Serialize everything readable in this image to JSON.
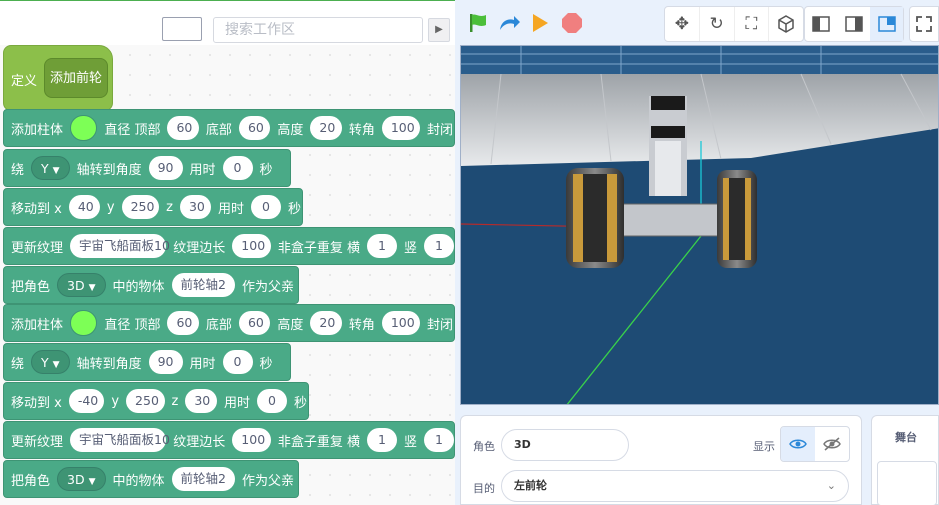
{
  "toolbar": {
    "search_placeholder": "搜索工作区"
  },
  "code": {
    "hat": {
      "label": "定义",
      "name": "添加前轮"
    },
    "blocks": [
      {
        "add_cyl": "添加柱体",
        "diam": "直径 顶部",
        "top": "60",
        "bottom_l": "底部",
        "bottom": "60",
        "height_l": "高度",
        "height": "20",
        "turn_l": "转角",
        "turn": "100",
        "seal": "封闭"
      },
      {
        "rotate": "绕",
        "axis": "Y",
        "to_angle": "轴转到角度",
        "angle": "90",
        "time_l": "用时",
        "time": "0",
        "sec": "秒"
      },
      {
        "move": "移动到 x",
        "x": "40",
        "y_l": "y",
        "y": "250",
        "z_l": "z",
        "z": "30",
        "time_l": "用时",
        "time": "0",
        "sec": "秒"
      },
      {
        "update": "更新纹理",
        "texture": "宇宙飞船面板10",
        "edge_l": "纹理边长",
        "edge": "100",
        "nonbox": "非盒子重复 横",
        "h": "1",
        "v_l": "竖",
        "v": "1"
      },
      {
        "set_role": "把角色",
        "role": "3D",
        "in_obj": "中的物体",
        "obj": "前轮轴2",
        "as_parent": "作为父亲"
      },
      {
        "add_cyl": "添加柱体",
        "diam": "直径 顶部",
        "top": "60",
        "bottom_l": "底部",
        "bottom": "60",
        "height_l": "高度",
        "height": "20",
        "turn_l": "转角",
        "turn": "100",
        "seal": "封闭"
      },
      {
        "rotate": "绕",
        "axis": "Y",
        "to_angle": "轴转到角度",
        "angle": "90",
        "time_l": "用时",
        "time": "0",
        "sec": "秒"
      },
      {
        "move": "移动到 x",
        "x": "-40",
        "y_l": "y",
        "y": "250",
        "z_l": "z",
        "z": "30",
        "time_l": "用时",
        "time": "0",
        "sec": "秒"
      },
      {
        "update": "更新纹理",
        "texture": "宇宙飞船面板10",
        "edge_l": "纹理边长",
        "edge": "100",
        "nonbox": "非盒子重复 横",
        "h": "1",
        "v_l": "竖",
        "v": "1"
      },
      {
        "set_role": "把角色",
        "role": "3D",
        "in_obj": "中的物体",
        "obj": "前轮轴2",
        "as_parent": "作为父亲"
      }
    ]
  },
  "sprite": {
    "role_label": "角色",
    "role_value": "3D",
    "show_label": "显示",
    "target_label": "目的",
    "target_value": "左前轮"
  },
  "stage_panel": {
    "title": "舞台"
  },
  "colors": {
    "block": "#4aaa87",
    "hat": "#8cbf4a",
    "cylinder_color": "#7dff56",
    "stage_bg": "#1e4b74"
  }
}
